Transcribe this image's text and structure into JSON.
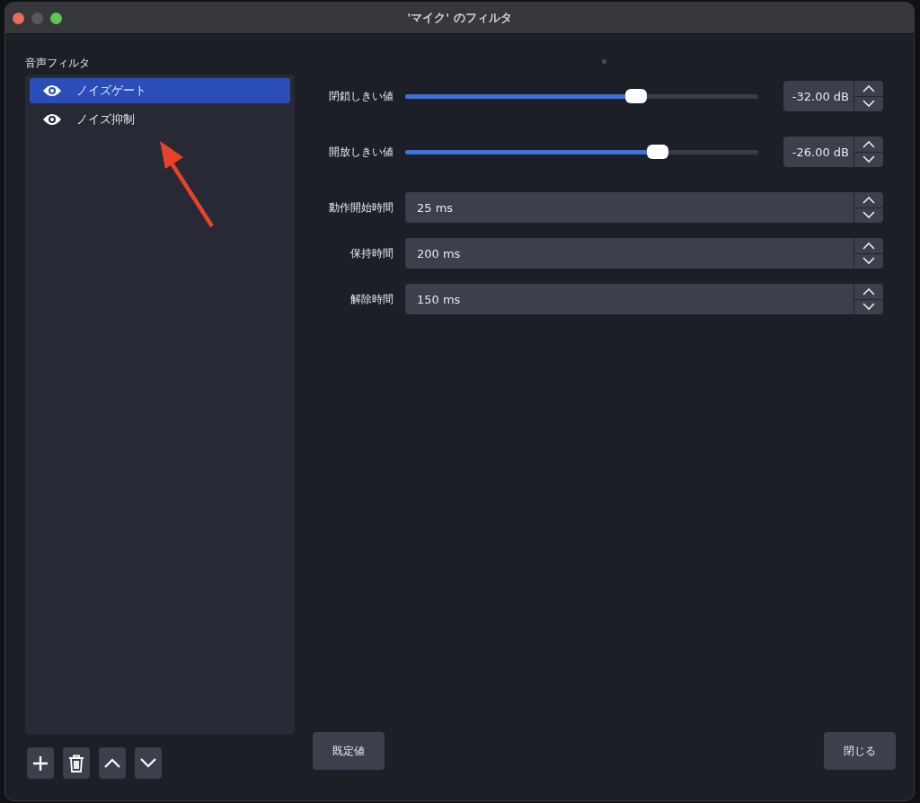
{
  "window": {
    "title": "'マイク' のフィルタ"
  },
  "filters": {
    "label": "音声フィルタ",
    "items": [
      {
        "name": "ノイズゲート",
        "visible": true,
        "selected": true
      },
      {
        "name": "ノイズ抑制",
        "visible": true,
        "selected": false
      }
    ]
  },
  "params": [
    {
      "kind": "slider",
      "label": "閉鎖しきい値",
      "level": 0.655,
      "value": "-32.00 dB"
    },
    {
      "kind": "slider",
      "label": "開放しきい値",
      "level": 0.714,
      "value": "-26.00 dB"
    },
    {
      "kind": "spin",
      "label": "動作開始時間",
      "value": "25 ms"
    },
    {
      "kind": "spin",
      "label": "保持時間",
      "value": "200 ms"
    },
    {
      "kind": "spin",
      "label": "解除時間",
      "value": "150 ms"
    }
  ],
  "buttons": {
    "defaults": "既定値",
    "close": "閉じる"
  }
}
